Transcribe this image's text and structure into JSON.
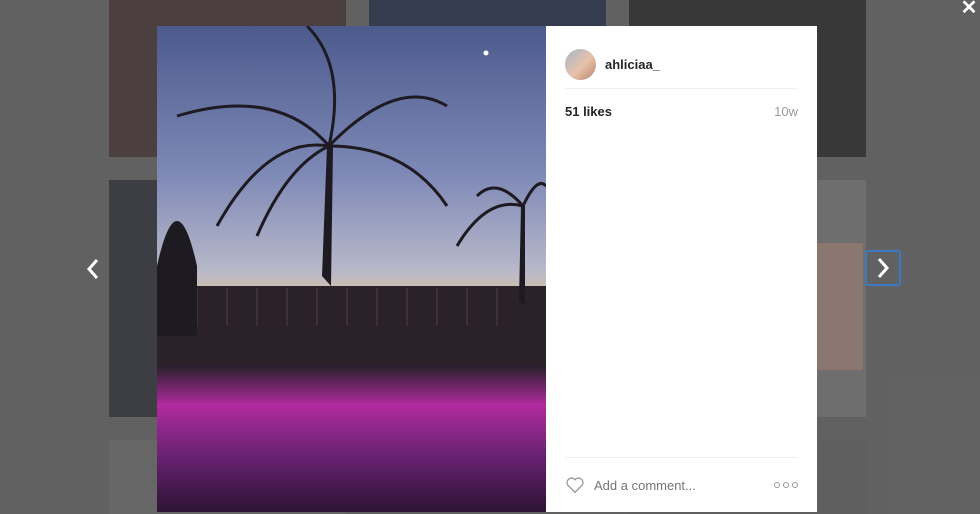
{
  "post": {
    "username": "ahliciaa_",
    "likes": "51 likes",
    "age": "10w"
  },
  "comment": {
    "placeholder": "Add a comment..."
  },
  "icons": {
    "close": "close-icon",
    "prev": "chevron-left-icon",
    "next": "chevron-right-icon",
    "like": "heart-icon",
    "more": "more-options-icon"
  },
  "colors": {
    "next_focus_border": "#3a78c2",
    "overlay": "#6b6b6b"
  }
}
